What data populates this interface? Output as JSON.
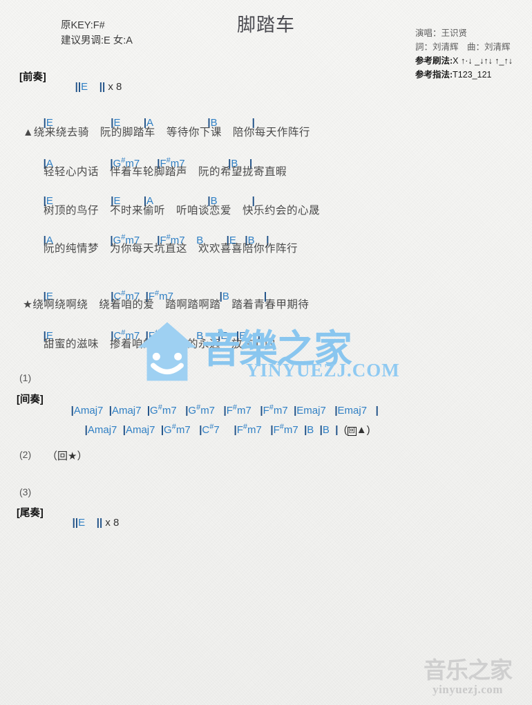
{
  "header": {
    "title": "脚踏车",
    "orig_key": "原KEY:F#",
    "suggest_key": "建议男调:E 女:A",
    "singer": "演唱：王识贤",
    "writers": "詞：刘清辉　曲：刘清辉",
    "strum_label": "参考刷法:",
    "strum_value": "X ↑·↓ _↓↑↓ ↑_↑↓",
    "finger_label": "参考指法:",
    "finger_value": "T123_121"
  },
  "intro": {
    "label": "[前奏]",
    "bars": "||E    || x 8"
  },
  "verse1": {
    "chords_1": "|E                    |E           |A                       |B             |",
    "lyrics_1": "▲绕来绕去骑　阮的脚踏车　等待你下课　陪你每天作阵行",
    "chords_2": "|A                    |G#m7        |F#m7                |B    |",
    "lyrics_2": "　轻轻心内话　伴着车轮脚踏声　阮的希望拢寄直暇",
    "chords_3": "|E                    |E           |A                       |B             |",
    "lyrics_3": "　树顶的鸟仔　不时来偷听　听咱谈恋爱　快乐约会的心晟",
    "chords_4": "|A                    |G#m7        |F#m7      B        |E    |B    |",
    "lyrics_4": "　阮的纯情梦　为你每天坑直这　欢欢喜喜陪你作阵行"
  },
  "chorus": {
    "chords_1": "|E                    |C#m7   |F#m7                 |B             |",
    "lyrics_1": "★绕啊绕啊绕　绕着咱的爱　踏啊踏啊踏　踏着青春甲期待",
    "chords_2": "|E                    |C#m7   |F#m7         B      |E    |E    |",
    "lyrics_2": "　甜蜜的滋味　掺着咱的爱　阮的永远　放在心内"
  },
  "sections": [
    {
      "number": "(1)",
      "label": "[间奏]",
      "line_1": "|Amaj7  |Amaj7  |G#m7   |G#m7   |F#m7   |F#m7   |Emaj7    |Emaj7    |",
      "line_2": "|Amaj7  |Amaj7  |G#m7   |C#7      |F#m7   |F#m7   |B   |B   |   (回▲)"
    },
    {
      "number": "(2)",
      "repeat": "（回★）"
    },
    {
      "number": "(3)",
      "label": "[尾奏]",
      "bars": "||E    || x 8"
    }
  ],
  "watermark": {
    "center_cn": "音樂之家",
    "center_en": "YINYUEZJ.COM",
    "bottom_cn": "音乐之家",
    "bottom_en": "yinyuezj.com"
  },
  "colors": {
    "chord": "#2f7fc4",
    "bar": "#1d4f86",
    "lyric": "#4a4a4a",
    "watermark_blue": "#8fcaf2",
    "watermark_gray": "#cfcfcf"
  }
}
